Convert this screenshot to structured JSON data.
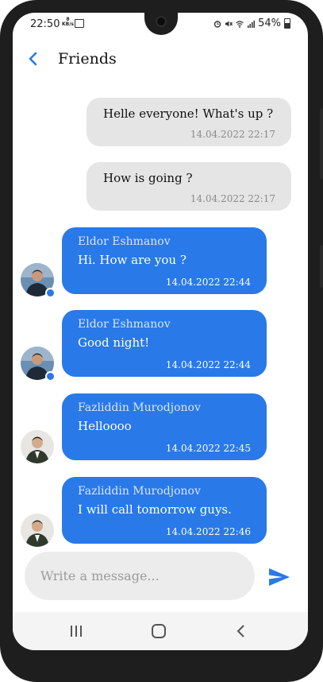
{
  "status_bar": {
    "time": "22:50",
    "net_speed_value": "8",
    "net_speed_unit": "KB/s",
    "battery": "54%"
  },
  "header": {
    "title": "Friends",
    "back_icon": "chevron-left-icon"
  },
  "colors": {
    "accent": "#2979e8",
    "outgoing_bubble": "#e5e5e5",
    "incoming_bubble": "#2979e8",
    "input_bg": "#ececec"
  },
  "messages": [
    {
      "direction": "out",
      "text": "Helle everyone! What's up ?",
      "time": "14.04.2022 22:17"
    },
    {
      "direction": "out",
      "text": "How is going ?",
      "time": "14.04.2022 22:17"
    },
    {
      "direction": "in",
      "sender": "Eldor Eshmanov",
      "text": "Hi. How are you ?",
      "time": "14.04.2022 22:44",
      "online": true
    },
    {
      "direction": "in",
      "sender": "Eldor Eshmanov",
      "text": "Good night!",
      "time": "14.04.2022 22:44",
      "online": true
    },
    {
      "direction": "in",
      "sender": "Fazliddin Murodjonov",
      "text": "Helloooo",
      "time": "14.04.2022 22:45",
      "online": false
    },
    {
      "direction": "in",
      "sender": "Fazliddin Murodjonov",
      "text": "I will call tomorrow guys.",
      "time": "14.04.2022 22:46",
      "online": false
    }
  ],
  "composer": {
    "placeholder": "Write a message...",
    "value": "",
    "send_icon": "send-icon"
  },
  "nav_bar": {
    "recents_icon": "recents-icon",
    "home_icon": "home-icon",
    "back_icon": "back-icon"
  }
}
